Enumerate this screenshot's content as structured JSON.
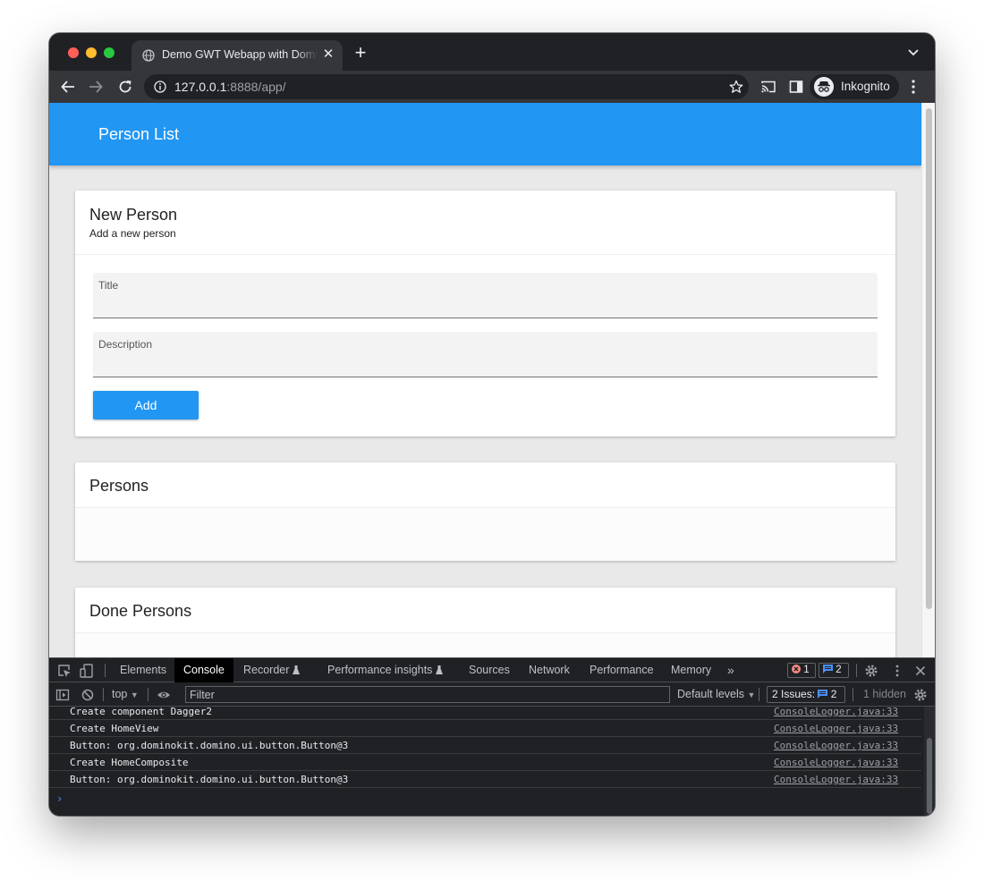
{
  "browser": {
    "tab_title": "Demo GWT Webapp with Domino",
    "tab_close": "✕",
    "new_tab": "+",
    "url_host": "127.0.0.1",
    "url_rest": ":8888/app/",
    "profile_label": "Inkognito"
  },
  "app": {
    "title": "Person List",
    "new_person": {
      "title": "New Person",
      "subtitle": "Add a new person",
      "title_field_label": "Title",
      "title_field_value": "",
      "description_field_label": "Description",
      "description_field_value": "",
      "add_button": "Add"
    },
    "persons_title": "Persons",
    "done_persons_title": "Done Persons"
  },
  "devtools": {
    "tabs": [
      "Elements",
      "Console",
      "Recorder",
      "Performance insights",
      "Sources",
      "Network",
      "Performance",
      "Memory"
    ],
    "active_tab": "Console",
    "more_tabs": "»",
    "error_count": "1",
    "message_count": "2",
    "context": "top",
    "filter_placeholder": "Filter",
    "levels": "Default levels",
    "issues_label": "2 Issues:",
    "issues_count": "2",
    "hidden": "1 hidden",
    "logs": [
      {
        "message": "Create component Dagger2",
        "source": "ConsoleLogger.java:33"
      },
      {
        "message": "Create HomeView",
        "source": "ConsoleLogger.java:33"
      },
      {
        "message": "Button: org.dominokit.domino.ui.button.Button@3",
        "source": "ConsoleLogger.java:33"
      },
      {
        "message": "Create HomeComposite",
        "source": "ConsoleLogger.java:33"
      },
      {
        "message": "Button: org.dominokit.domino.ui.button.Button@3",
        "source": "ConsoleLogger.java:33"
      }
    ],
    "prompt": "›"
  },
  "colors": {
    "primary": "#2196f3",
    "chrome_dark": "#202124",
    "chrome_toolbar": "#35363a",
    "page_background": "#e9e9e9"
  }
}
